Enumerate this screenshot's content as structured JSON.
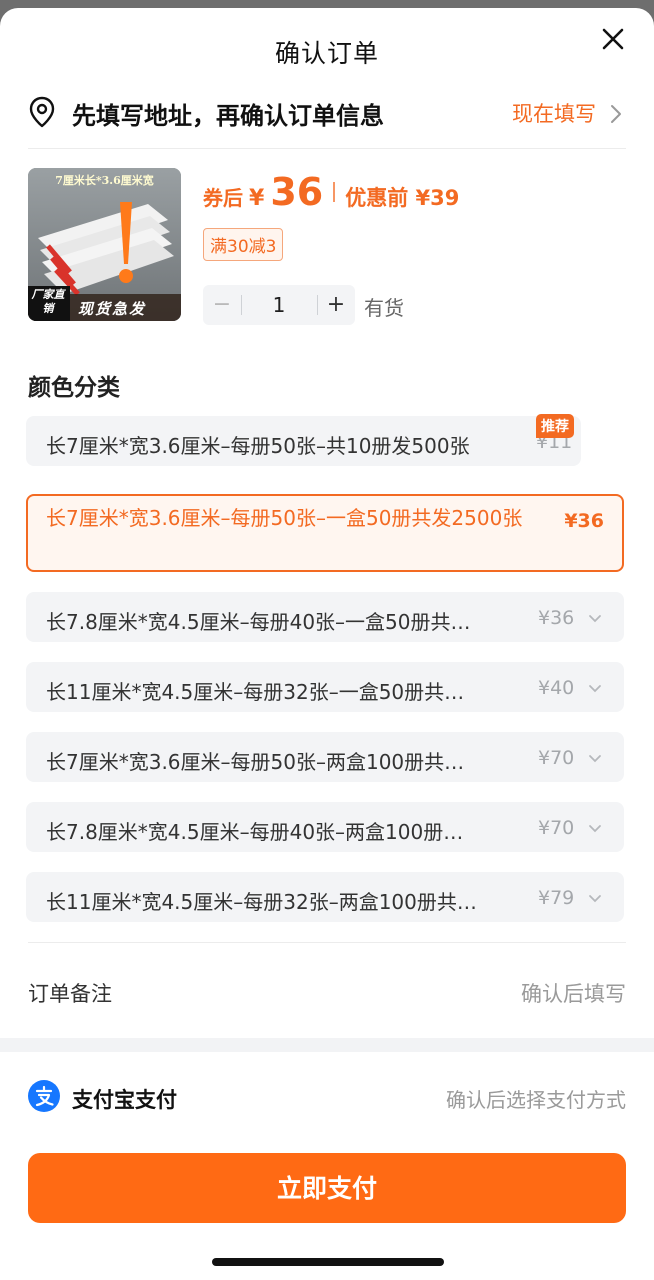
{
  "header": {
    "title": "确认订单"
  },
  "address": {
    "prompt": "先填写地址，再确认订单信息",
    "action_label": "现在填写"
  },
  "product": {
    "thumb_top_text": "7厘米长*3.6厘米宽",
    "thumb_badge_left": "厂家直销",
    "thumb_badge_right": "现货急发",
    "price_label": "券后",
    "currency": "¥",
    "price": "36",
    "orig_price_text": "优惠前 ¥39",
    "coupon": "满30减3",
    "quantity": "1",
    "stock": "有货"
  },
  "options_title": "颜色分类",
  "options": [
    {
      "label": "长7厘米*宽3.6厘米–每册50张–共10册发500张",
      "price": "¥11",
      "badge": "推荐"
    },
    {
      "label": "长7厘米*宽3.6厘米–每册50张–一盒50册共发2500张",
      "price": "¥36"
    },
    {
      "label": "长7.8厘米*宽4.5厘米–每册40张–一盒50册共…",
      "price": "¥36"
    },
    {
      "label": "长11厘米*宽4.5厘米–每册32张–一盒50册共…",
      "price": "¥40"
    },
    {
      "label": "长7厘米*宽3.6厘米–每册50张–两盒100册共…",
      "price": "¥70"
    },
    {
      "label": "长7.8厘米*宽4.5厘米–每册40张–两盒100册…",
      "price": "¥70"
    },
    {
      "label": "长11厘米*宽4.5厘米–每册32张–两盒100册共…",
      "price": "¥79"
    }
  ],
  "remark": {
    "label": "订单备注",
    "value": "确认后填写"
  },
  "payment": {
    "method": "支付宝支付",
    "hint": "确认后选择支付方式"
  },
  "pay_button": "立即支付",
  "colors": {
    "accent": "#f36a22",
    "button": "#ff6a14",
    "alipay": "#1677ff"
  }
}
